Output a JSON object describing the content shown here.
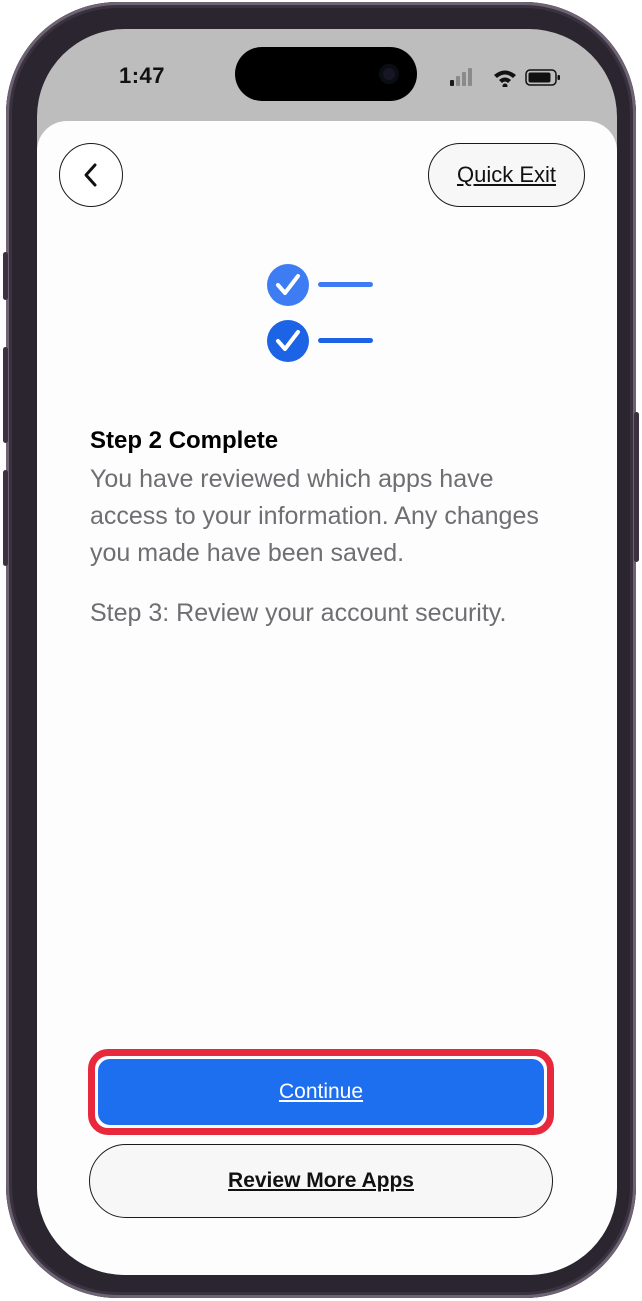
{
  "status_bar": {
    "time": "1:47",
    "icons": [
      "cellular-signal-icon",
      "wifi-icon",
      "battery-icon"
    ]
  },
  "nav": {
    "back_icon": "chevron-left-icon",
    "quick_exit_label": "Quick Exit"
  },
  "illustration": {
    "icon": "checklist-icon",
    "checked_items": 2,
    "accent_color": "#2d6ef2"
  },
  "content": {
    "title": "Step 2 Complete",
    "description": "You have reviewed which apps have access to your information. Any changes you made have been saved.",
    "next_step": "Step 3: Review your account security."
  },
  "actions": {
    "continue_label": "Continue",
    "review_more_label": "Review More Apps"
  },
  "colors": {
    "primary_button": "#1e6ef0",
    "highlight_outline": "#e8283c",
    "secondary_text": "#6e6e73"
  }
}
